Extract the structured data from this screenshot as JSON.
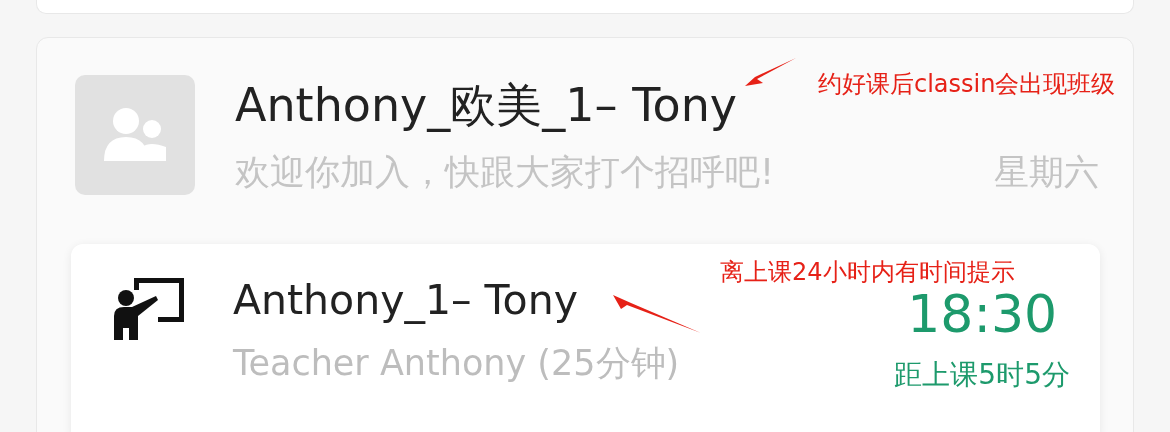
{
  "group_chat": {
    "title": "Anthony_欧美_1– Tony",
    "last_message": "欢迎你加入，快跟大家打个招呼吧!",
    "day": "星期六"
  },
  "lesson": {
    "title": "Anthony_1– Tony",
    "teacher": "Teacher Anthony (25分钟)",
    "time": "18:30",
    "countdown": "距上课5时5分"
  },
  "annotations": [
    {
      "text": "约好课后classin会出现班级"
    },
    {
      "text": "离上课24小时内有时间提示"
    }
  ]
}
